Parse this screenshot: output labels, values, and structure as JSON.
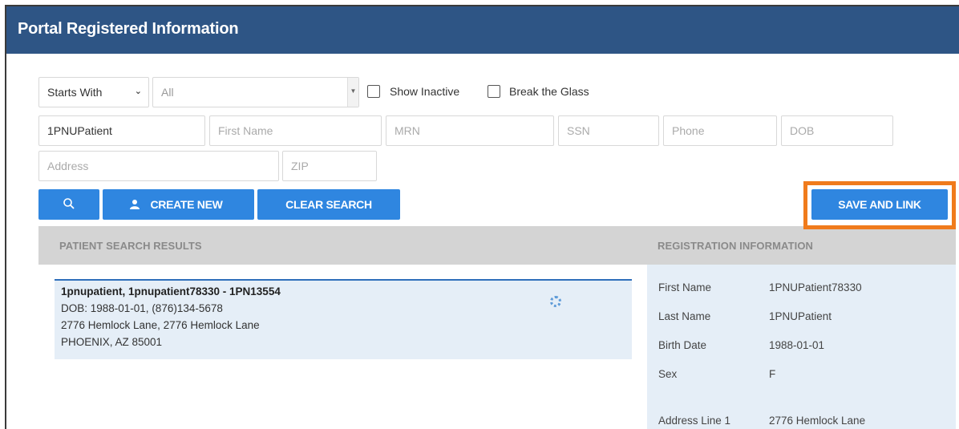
{
  "header": {
    "title": "Portal Registered Information"
  },
  "search": {
    "mode_select": "Starts With",
    "type_select": "All",
    "show_inactive_label": "Show Inactive",
    "break_glass_label": "Break the Glass",
    "last_name_value": "1PNUPatient",
    "first_name_placeholder": "First Name",
    "mrn_placeholder": "MRN",
    "ssn_placeholder": "SSN",
    "phone_placeholder": "Phone",
    "dob_placeholder": "DOB",
    "address_placeholder": "Address",
    "zip_placeholder": "ZIP"
  },
  "buttons": {
    "create_new": "CREATE NEW",
    "clear_search": "CLEAR SEARCH",
    "save_and_link": "SAVE AND LINK"
  },
  "colors": {
    "header_bg": "#2e5585",
    "button_bg": "#2f86e0",
    "highlight": "#f07b1c",
    "panel_bg": "#e5eef7"
  },
  "results": {
    "heading": "PATIENT SEARCH RESULTS",
    "items": [
      {
        "name": "1pnupatient, 1pnupatient78330 - 1PN13554",
        "dob_phone": "DOB: 1988-01-01, (876)134-5678",
        "address": "2776 Hemlock Lane, 2776 Hemlock Lane",
        "city": "PHOENIX, AZ 85001",
        "icon": "gear-icon"
      }
    ]
  },
  "registration": {
    "heading": "REGISTRATION INFORMATION",
    "rows": [
      {
        "label": "First Name",
        "value": "1PNUPatient78330"
      },
      {
        "label": "Last Name",
        "value": "1PNUPatient"
      },
      {
        "label": "Birth Date",
        "value": "1988-01-01"
      },
      {
        "label": "Sex",
        "value": "F"
      },
      {
        "label": "Address Line 1",
        "value": "2776 Hemlock Lane"
      }
    ]
  }
}
